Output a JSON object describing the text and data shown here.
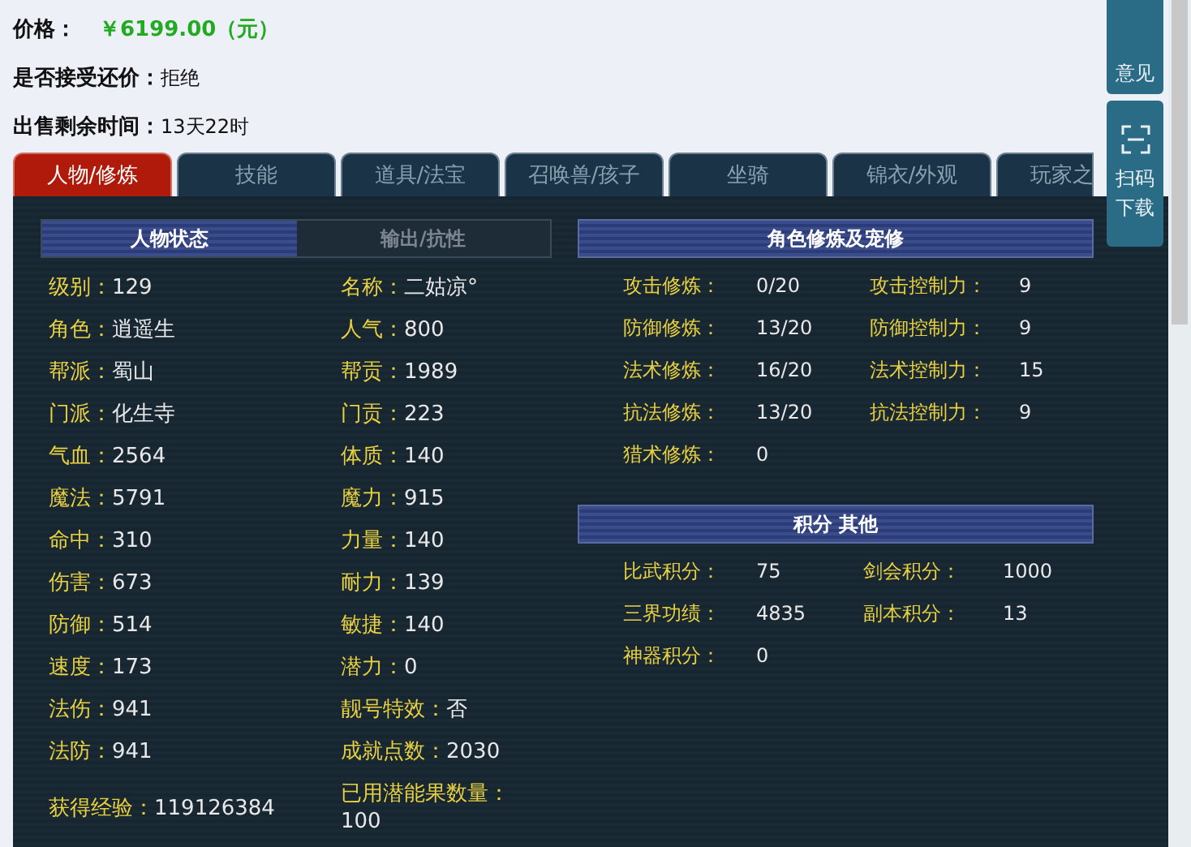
{
  "summary": [
    {
      "label": "价格：",
      "value": "￥6199.00（元）",
      "kind": "price"
    },
    {
      "label": "是否接受还价：",
      "value": "拒绝",
      "kind": "plain"
    },
    {
      "label": "出售剩余时间：",
      "value": "13天22时",
      "kind": "plain"
    }
  ],
  "tabs": [
    {
      "label": "人物/修炼",
      "selected": true
    },
    {
      "label": "技能",
      "selected": false
    },
    {
      "label": "道具/法宝",
      "selected": false
    },
    {
      "label": "召唤兽/孩子",
      "selected": false
    },
    {
      "label": "坐骑",
      "selected": false
    },
    {
      "label": "锦衣/外观",
      "selected": false
    },
    {
      "label": "玩家之",
      "selected": false
    }
  ],
  "subtabs": [
    {
      "label": "人物状态",
      "selected": true
    },
    {
      "label": "输出/抗性",
      "selected": false
    }
  ],
  "stats": [
    [
      {
        "label": "级别：",
        "value": "129"
      },
      {
        "label": "名称：",
        "value": "二姑凉°"
      }
    ],
    [
      {
        "label": "角色：",
        "value": "逍遥生"
      },
      {
        "label": "人气：",
        "value": "800"
      }
    ],
    [
      {
        "label": "帮派：",
        "value": "蜀山"
      },
      {
        "label": "帮贡：",
        "value": "1989"
      }
    ],
    [
      {
        "label": "门派：",
        "value": "化生寺"
      },
      {
        "label": "门贡：",
        "value": "223"
      }
    ],
    [
      {
        "label": "气血：",
        "value": "2564"
      },
      {
        "label": "体质：",
        "value": "140"
      }
    ],
    [
      {
        "label": "魔法：",
        "value": "5791"
      },
      {
        "label": "魔力：",
        "value": "915"
      }
    ],
    [
      {
        "label": "命中：",
        "value": "310"
      },
      {
        "label": "力量：",
        "value": "140"
      }
    ],
    [
      {
        "label": "伤害：",
        "value": "673"
      },
      {
        "label": "耐力：",
        "value": "139"
      }
    ],
    [
      {
        "label": "防御：",
        "value": "514"
      },
      {
        "label": "敏捷：",
        "value": "140"
      }
    ],
    [
      {
        "label": "速度：",
        "value": "173"
      },
      {
        "label": "潜力：",
        "value": "0"
      }
    ],
    [
      {
        "label": "法伤：",
        "value": "941"
      },
      {
        "label": "靓号特效：",
        "value": "否"
      }
    ],
    [
      {
        "label": "法防：",
        "value": "941"
      },
      {
        "label": "成就点数：",
        "value": "2030"
      }
    ],
    [
      {
        "label": "获得经验：",
        "value": "119126384"
      },
      {
        "label": "已用潜能果数量：",
        "value": "100"
      }
    ]
  ],
  "sections": [
    {
      "title": "角色修炼及宠修",
      "rows": [
        [
          {
            "label": "攻击修炼：",
            "value": "0/20"
          },
          {
            "label": "攻击控制力：",
            "value": "9"
          }
        ],
        [
          {
            "label": "防御修炼：",
            "value": "13/20"
          },
          {
            "label": "防御控制力：",
            "value": "9"
          }
        ],
        [
          {
            "label": "法术修炼：",
            "value": "16/20"
          },
          {
            "label": "法术控制力：",
            "value": "15"
          }
        ],
        [
          {
            "label": "抗法修炼：",
            "value": "13/20"
          },
          {
            "label": "抗法控制力：",
            "value": "9"
          }
        ],
        [
          {
            "label": "猎术修炼：",
            "value": "0"
          }
        ]
      ]
    },
    {
      "title": "积分 其他",
      "rows": [
        [
          {
            "label": "比武积分：",
            "value": "75"
          },
          {
            "label": "剑会积分：",
            "value": "1000"
          }
        ],
        [
          {
            "label": "三界功绩：",
            "value": "4835"
          },
          {
            "label": "副本积分：",
            "value": "13"
          }
        ],
        [
          {
            "label": "神器积分：",
            "value": "0"
          }
        ]
      ]
    }
  ],
  "side_buttons": [
    {
      "label": "意见",
      "kind": "text"
    },
    {
      "label": "扫码下载",
      "kind": "scan"
    }
  ]
}
